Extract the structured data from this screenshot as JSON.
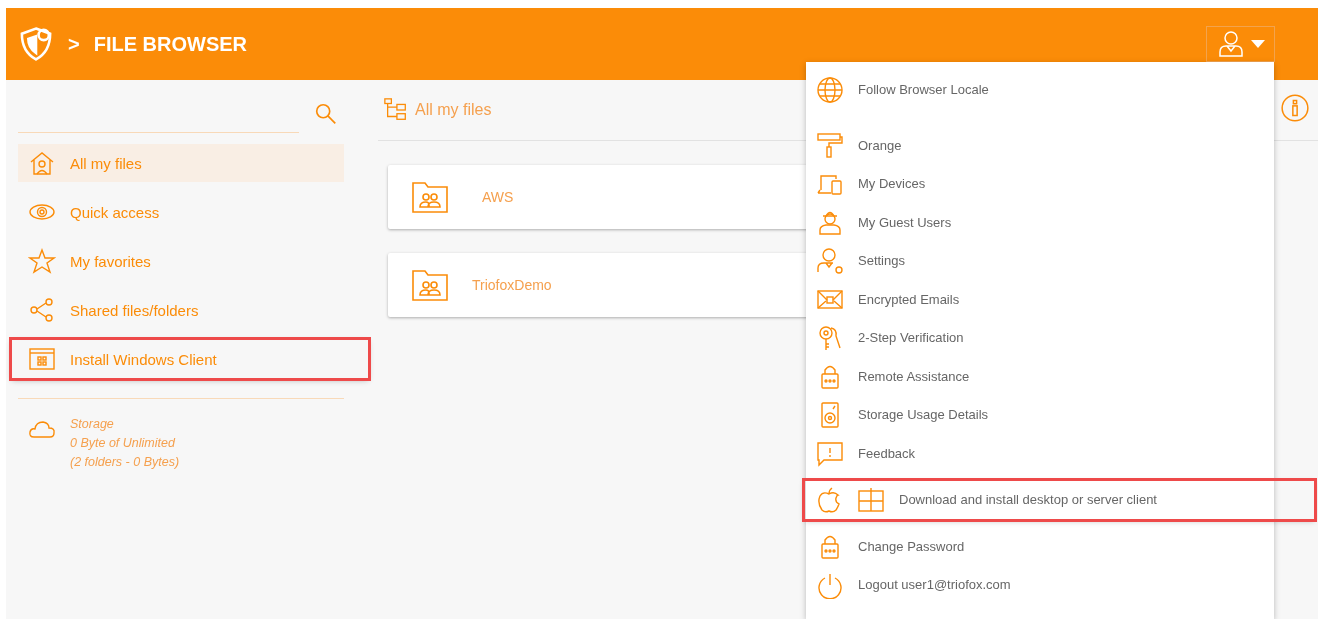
{
  "header": {
    "separator": ">",
    "title": "FILE BROWSER"
  },
  "sidebar": {
    "items": [
      {
        "label": "All my files",
        "selected": true,
        "highlighted": false
      },
      {
        "label": "Quick access",
        "selected": false,
        "highlighted": false
      },
      {
        "label": "My favorites",
        "selected": false,
        "highlighted": false
      },
      {
        "label": "Shared files/folders",
        "selected": false,
        "highlighted": false
      },
      {
        "label": "Install Windows Client",
        "selected": false,
        "highlighted": true
      }
    ],
    "storage": {
      "title": "Storage",
      "usage": "0 Byte of Unlimited",
      "detail": "(2 folders - 0 Bytes)"
    }
  },
  "breadcrumb": "All my files",
  "folders": [
    {
      "name": "AWS"
    },
    {
      "name": "TriofoxDemo"
    }
  ],
  "user_menu": {
    "items": [
      {
        "label": "Follow Browser Locale",
        "highlighted": false
      },
      {
        "label": "Orange",
        "highlighted": false
      },
      {
        "label": "My Devices",
        "highlighted": false
      },
      {
        "label": "My Guest Users",
        "highlighted": false
      },
      {
        "label": "Settings",
        "highlighted": false
      },
      {
        "label": "Encrypted Emails",
        "highlighted": false
      },
      {
        "label": "2-Step Verification",
        "highlighted": false
      },
      {
        "label": "Remote Assistance",
        "highlighted": false
      },
      {
        "label": "Storage Usage Details",
        "highlighted": false
      },
      {
        "label": "Feedback",
        "highlighted": false
      },
      {
        "label": "Download and install desktop or server client",
        "highlighted": true
      },
      {
        "label": "Change Password",
        "highlighted": false
      },
      {
        "label": "Logout user1@triofox.com",
        "highlighted": false
      }
    ]
  }
}
